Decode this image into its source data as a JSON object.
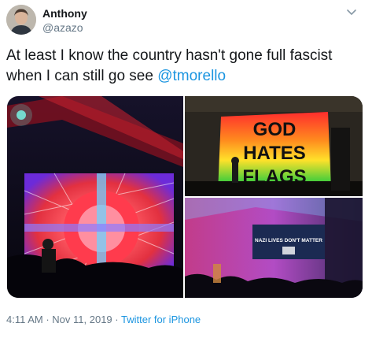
{
  "author": {
    "name": "Anthony",
    "handle": "@azazo"
  },
  "tweet": {
    "text_before": "At least I know the country hasn't gone full fascist when I can still go see ",
    "mention": "@tmorello"
  },
  "photos": {
    "photo2_sign": [
      "GOD",
      "HATES",
      "FLAGS"
    ],
    "photo3_screen_text": "NAZI LIVES DON'T MATTER"
  },
  "meta": {
    "time": "4:11 AM",
    "sep1": " · ",
    "date": "Nov 11, 2019",
    "sep2": " · ",
    "source": "Twitter for iPhone"
  },
  "icons": {
    "menu": "chevron-down-icon"
  },
  "colors": {
    "link": "#1b95e0",
    "secondary_text": "#657786"
  }
}
